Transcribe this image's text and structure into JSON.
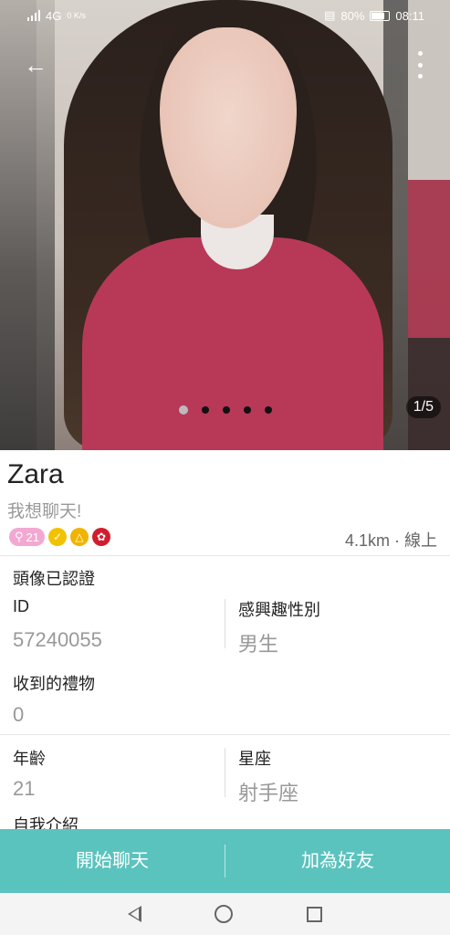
{
  "status_bar": {
    "network_label": "4G",
    "speed": "0 K/s",
    "battery": "80%",
    "time": "08:11"
  },
  "photo": {
    "counter": "1/5",
    "page_count": 5,
    "current_page": 1
  },
  "profile": {
    "name": "Zara",
    "tagline": "我想聊天!",
    "level": "21",
    "distance_status": "4.1km · 線上",
    "avatar_verified": "頭像已認證"
  },
  "fields": {
    "id_label": "ID",
    "id_value": "57240055",
    "interest_label": "感興趣性別",
    "interest_value": "男生",
    "gifts_label": "收到的禮物",
    "gifts_value": "0",
    "age_label": "年齡",
    "age_value": "21",
    "zodiac_label": "星座",
    "zodiac_value": "射手座",
    "intro_label": "自我介紹"
  },
  "actions": {
    "chat": "開始聊天",
    "add_friend": "加為好友"
  },
  "colors": {
    "accent": "#5bc3be",
    "level_badge": "#f3a8d2"
  }
}
